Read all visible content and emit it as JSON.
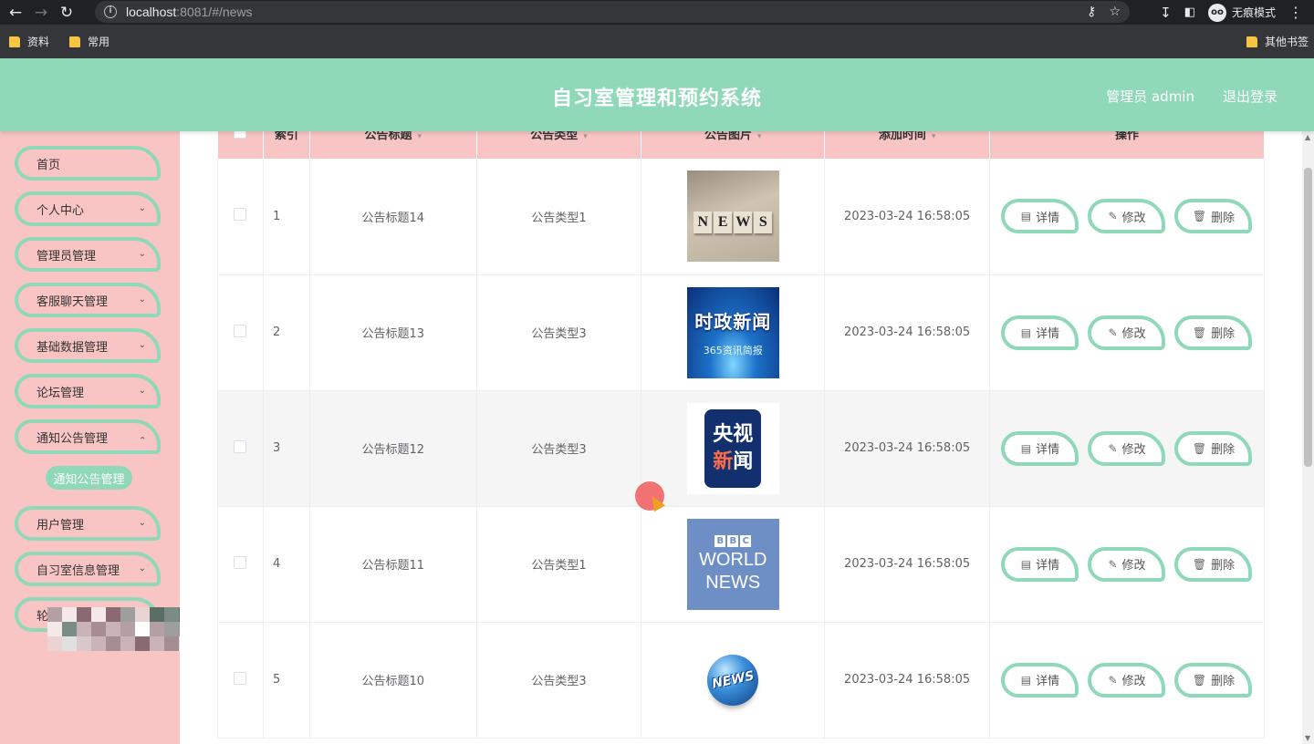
{
  "browser": {
    "url_host": "localhost",
    "url_rest": ":8081/#/news",
    "incognito_label": "无痕模式",
    "bookmarks": [
      "资料",
      "常用"
    ],
    "other_bookmarks": "其他书签"
  },
  "header": {
    "title": "自习室管理和预约系统",
    "user": "管理员 admin",
    "logout": "退出登录"
  },
  "sidebar": {
    "items": [
      {
        "label": "首页"
      },
      {
        "label": "个人中心"
      },
      {
        "label": "管理员管理"
      },
      {
        "label": "客服聊天管理"
      },
      {
        "label": "基础数据管理"
      },
      {
        "label": "论坛管理"
      },
      {
        "label": "通知公告管理"
      },
      {
        "label": "用户管理"
      },
      {
        "label": "自习室信息管理"
      },
      {
        "label": "轮"
      }
    ],
    "active_sub": "通知公告管理"
  },
  "table": {
    "headers": [
      "索引",
      "公告标题",
      "公告类型",
      "公告图片",
      "添加时间",
      "操作"
    ],
    "rows": [
      {
        "index": "1",
        "title": "公告标题14",
        "type": "公告类型1",
        "image": "news-blocks",
        "time": "2023-03-24 16:58:05"
      },
      {
        "index": "2",
        "title": "公告标题13",
        "type": "公告类型3",
        "image": "shizheng",
        "time": "2023-03-24 16:58:05"
      },
      {
        "index": "3",
        "title": "公告标题12",
        "type": "公告类型3",
        "image": "cctv",
        "time": "2023-03-24 16:58:05"
      },
      {
        "index": "4",
        "title": "公告标题11",
        "type": "公告类型1",
        "image": "bbc",
        "time": "2023-03-24 16:58:05"
      },
      {
        "index": "5",
        "title": "公告标题10",
        "type": "公告类型3",
        "image": "globe",
        "time": "2023-03-24 16:58:05"
      }
    ],
    "actions": {
      "detail": "详情",
      "edit": "修改",
      "delete": "删除"
    }
  },
  "images": {
    "news_letters": [
      "N",
      "E",
      "W",
      "S"
    ],
    "shizheng_title": "时政新闻",
    "shizheng_sub": "365资讯简报",
    "cctv_line1": "央视",
    "cctv_line2a": "新",
    "cctv_line2b": "闻",
    "bbc_letters": [
      "B",
      "B",
      "C"
    ],
    "bbc_line1": "WORLD",
    "bbc_line2": "NEWS",
    "globe_text": "NEWS"
  }
}
